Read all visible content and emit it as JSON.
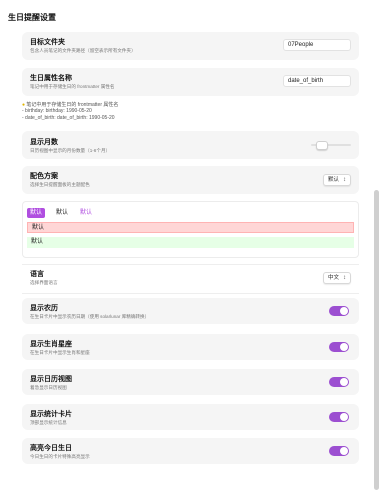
{
  "page": {
    "title": "生日提醒设置"
  },
  "settings": {
    "folder": {
      "label": "目标文件夹",
      "desc": "包含人员笔记的文件夹路径（留空表示所有文件夹）",
      "value": "07People"
    },
    "property": {
      "label": "生日属性名称",
      "desc": "笔记中用于存储生日的 frontmatter 属性名",
      "value": "date_of_birth"
    },
    "property_note": {
      "line1": "笔记中用于存储生日的 frontmatter 属性名",
      "line2": "- birthday: birthday: 1990-05-20",
      "line3": "- date_of_birth: date_of_birth: 1990-05-20"
    },
    "months": {
      "label": "显示月数",
      "desc": "日历视图中显示的月份数量（1-6个月）",
      "level": 0.25
    },
    "colors": {
      "label": "配色方案",
      "desc": "选择生日提醒面板的主题配色",
      "value": "默认"
    },
    "preview": {
      "chips": [
        "默认",
        "默认",
        "默认"
      ],
      "row1": "默认",
      "row2": "默认"
    },
    "language": {
      "label": "语言",
      "desc": "选择界面语言",
      "value": "中文"
    },
    "lunar": {
      "label": "显示农历",
      "desc": "在生日卡片中显示农历日期（使用 solarlunar 库精确转换）",
      "on": true
    },
    "zodiac": {
      "label": "显示生肖星座",
      "desc": "在生日卡片中显示生肖和星座",
      "on": true
    },
    "calendar": {
      "label": "显示日历视图",
      "desc": "着急显示日历视图",
      "on": true
    },
    "stats": {
      "label": "显示统计卡片",
      "desc": "顶部显示统计信息",
      "on": true
    },
    "highlight": {
      "label": "高亮今日生日",
      "desc": "今日生日的卡片特殊高亮显示",
      "on": true
    }
  },
  "colors": {
    "accent": "#9c4fd1",
    "chip_active_bg": "#b04ee0",
    "row_red": "#ffd6d6",
    "row_green": "#e6ffe6"
  }
}
